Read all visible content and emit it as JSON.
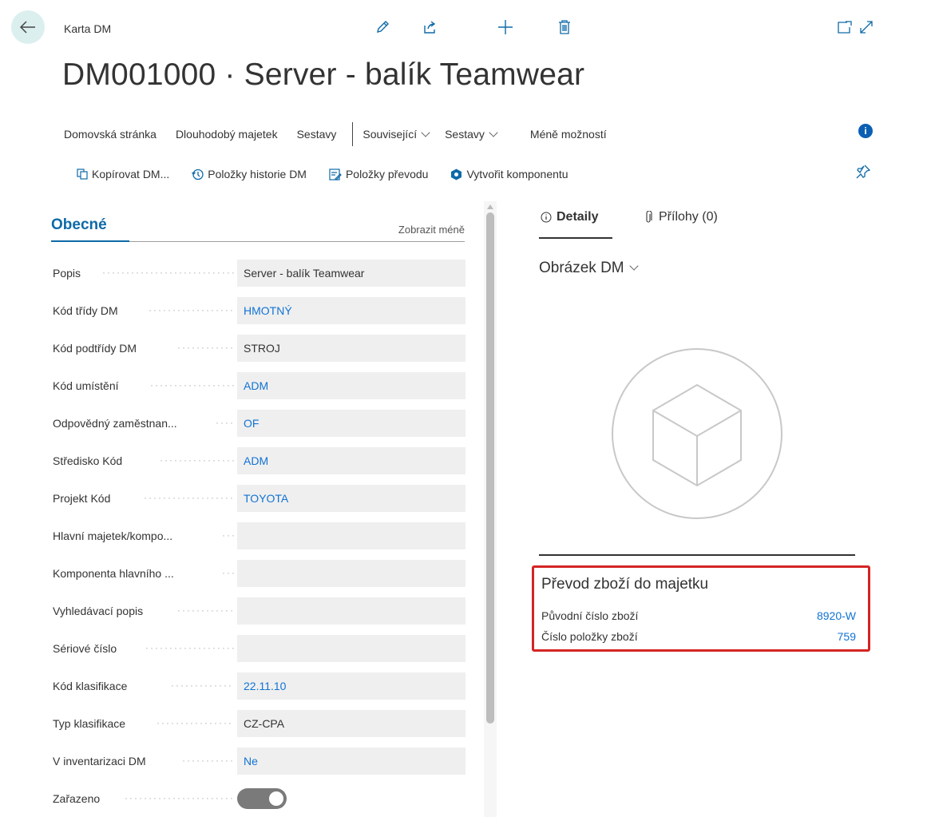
{
  "header": {
    "page_kind": "Karta DM",
    "title": "DM001000 · Server - balík Teamwear"
  },
  "menu": {
    "items": [
      "Domovská stránka",
      "Dlouhodobý majetek",
      "Sestavy"
    ],
    "dropdowns": [
      "Související",
      "Sestavy"
    ],
    "less_options": "Méně možností"
  },
  "actions": {
    "copy": "Kopírovat DM...",
    "history": "Položky historie DM",
    "transfer": "Položky převodu",
    "component": "Vytvořit komponentu"
  },
  "general": {
    "section_title": "Obecné",
    "show_less": "Zobrazit méně",
    "fields": [
      {
        "label": "Popis",
        "value": "Server - balík Teamwear"
      },
      {
        "label": "Kód třídy DM",
        "value": "HMOTNÝ"
      },
      {
        "label": "Kód podtřídy DM",
        "value": "STROJ"
      },
      {
        "label": "Kód umístění",
        "value": "ADM"
      },
      {
        "label": "Odpovědný zaměstnan...",
        "value": "OF"
      },
      {
        "label": "Středisko Kód",
        "value": "ADM"
      },
      {
        "label": "Projekt Kód",
        "value": "TOYOTA"
      },
      {
        "label": "Hlavní majetek/kompo...",
        "value": ""
      },
      {
        "label": "Komponenta hlavního ...",
        "value": ""
      },
      {
        "label": "Vyhledávací popis",
        "value": ""
      },
      {
        "label": "Sériové číslo",
        "value": ""
      },
      {
        "label": "Kód klasifikace",
        "value": "22.11.10"
      },
      {
        "label": "Typ klasifikace",
        "value": "CZ-CPA"
      },
      {
        "label": "V inventarizaci DM",
        "value": "Ne"
      },
      {
        "label": "Zařazeno",
        "value": ""
      }
    ]
  },
  "factbox": {
    "tab_details": "Detaily",
    "tab_attachments": "Přílohy (0)",
    "picture_title": "Obrázek DM",
    "transfer": {
      "title": "Převod zboží do majetku",
      "orig_label": "Původní číslo zboží",
      "orig_value": "8920-W",
      "entry_label": "Číslo položky zboží",
      "entry_value": "759"
    }
  },
  "colors": {
    "accent": "#0e6aa8",
    "link": "#1173d4",
    "highlight": "#d42424"
  }
}
